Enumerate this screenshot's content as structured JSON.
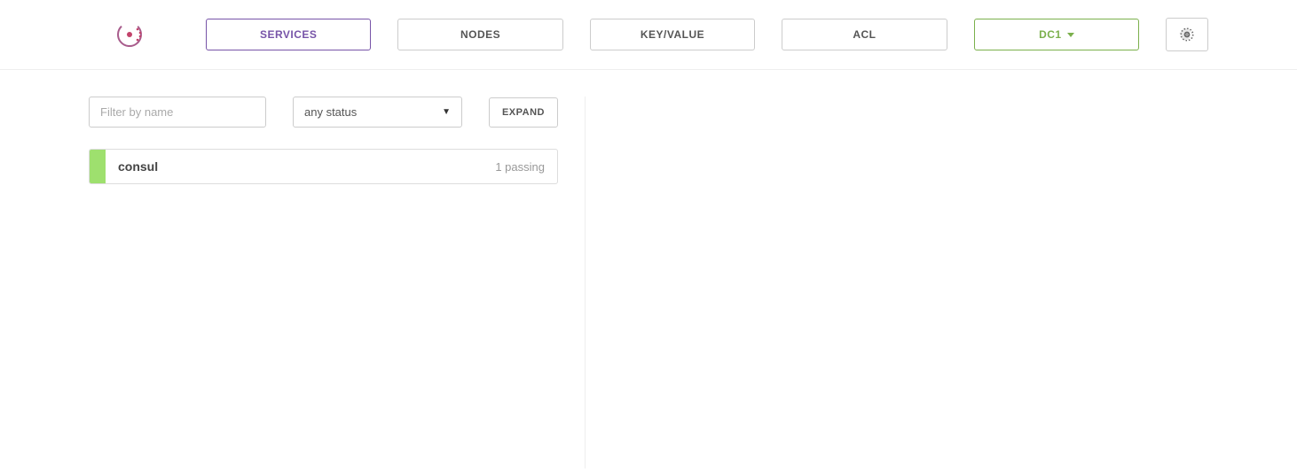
{
  "nav": {
    "tabs": [
      {
        "label": "SERVICES",
        "active": true
      },
      {
        "label": "NODES",
        "active": false
      },
      {
        "label": "KEY/VALUE",
        "active": false
      },
      {
        "label": "ACL",
        "active": false
      }
    ],
    "datacenter": "DC1"
  },
  "filters": {
    "name_placeholder": "Filter by name",
    "status_selected": "any status",
    "expand_label": "EXPAND"
  },
  "services": [
    {
      "name": "consul",
      "status_text": "1 passing",
      "status_color": "#9ee06e"
    }
  ]
}
